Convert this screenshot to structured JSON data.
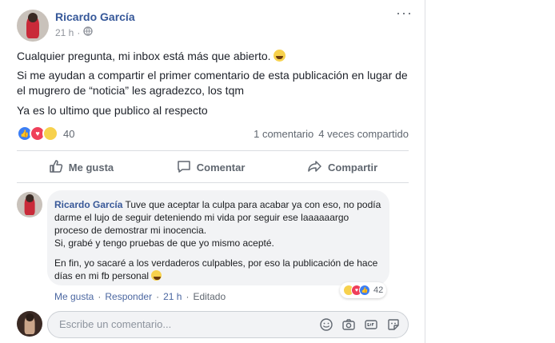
{
  "post": {
    "author": "Ricardo García",
    "time": "21 h",
    "paragraphs": [
      "Cualquier pregunta, mi inbox está más que abierto.",
      "Si me ayudan a compartir el primer comentario de esta publicación en lugar de el mugrero de “noticia” les agradezco, los tqm",
      "Ya es lo ultimo que publico al respecto"
    ],
    "reactions_count": "40",
    "comments_count": "1 comentario",
    "shares_count": "4 veces compartido",
    "actions": {
      "like": "Me gusta",
      "comment": "Comentar",
      "share": "Compartir"
    }
  },
  "comment": {
    "author": "Ricardo García",
    "text_1": "Tuve que aceptar la culpa para acabar ya con eso, no podía darme el lujo de seguir deteniendo mi vida por seguir ese laaaaaargo proceso de demostrar mi inocencia.",
    "text_2": "Si, grabé y tengo pruebas de que yo mismo acepté.",
    "text_3": "En fin, yo sacaré a los verdaderos culpables, por eso la publicación de hace días en mi fb personal",
    "reactions_count": "42",
    "like": "Me gusta",
    "reply": "Responder",
    "time": "21 h",
    "edited": "Editado",
    "sep": "·"
  },
  "composer": {
    "placeholder": "Escribe un comentario..."
  },
  "colors": {
    "link": "#365899",
    "like": "#3b7ef5",
    "love": "#ef3f5a",
    "haha": "#f7d14d"
  }
}
